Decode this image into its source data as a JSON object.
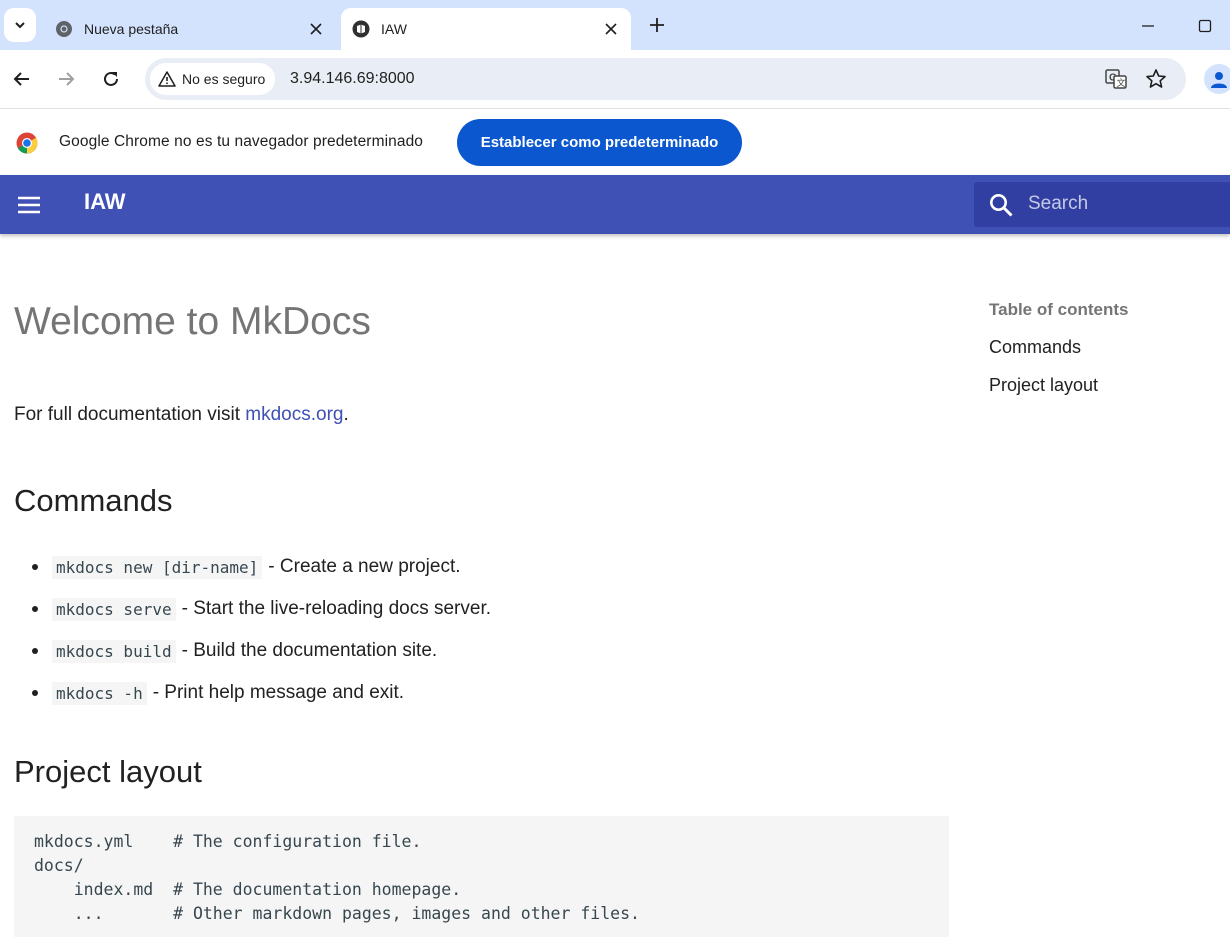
{
  "browser": {
    "tabs": [
      {
        "title": "Nueva pestaña",
        "active": false,
        "favicon": "chrome-icon"
      },
      {
        "title": "IAW",
        "active": true,
        "favicon": "mkdocs-icon"
      }
    ],
    "security_chip": "No es seguro",
    "url": "3.94.146.69:8000",
    "infobar": {
      "message": "Google Chrome no es tu navegador predeterminado",
      "button_label": "Establecer como predeterminado"
    },
    "colors": {
      "tabstrip": "#d3e3fd",
      "omnibox": "#e9eef6",
      "cta": "#0b57d0"
    }
  },
  "site": {
    "title": "IAW",
    "search_placeholder": "Search",
    "colors": {
      "header": "#3f51b5",
      "search": "#303fa1",
      "link": "#3f51b5"
    }
  },
  "page": {
    "heading": "Welcome to MkDocs",
    "intro_prefix": "For full documentation visit ",
    "intro_link": "mkdocs.org",
    "intro_suffix": ".",
    "commands_heading": "Commands",
    "commands": [
      {
        "code": "mkdocs new [dir-name]",
        "desc": "- Create a new project."
      },
      {
        "code": "mkdocs serve",
        "desc": "- Start the live-reloading docs server."
      },
      {
        "code": "mkdocs build",
        "desc": "- Build the documentation site."
      },
      {
        "code": "mkdocs -h",
        "desc": "- Print help message and exit."
      }
    ],
    "layout_heading": "Project layout",
    "layout_code": "mkdocs.yml    # The configuration file.\ndocs/\n    index.md  # The documentation homepage.\n    ...       # Other markdown pages, images and other files."
  },
  "toc": {
    "label": "Table of contents",
    "items": [
      "Commands",
      "Project layout"
    ]
  }
}
